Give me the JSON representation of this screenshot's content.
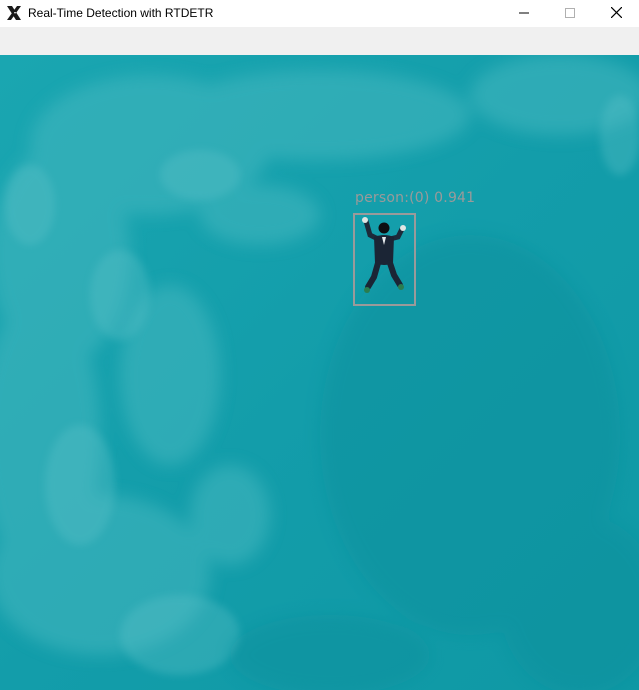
{
  "window": {
    "title": "Real-Time Detection with RTDETR",
    "app_icon": "x-app-icon",
    "controls": {
      "minimize_icon": "minimize-icon",
      "maximize_icon": "maximize-icon",
      "close_icon": "close-icon"
    }
  },
  "detections": [
    {
      "label": "person:(0)  0.941",
      "class": "person",
      "id": 0,
      "confidence": 0.941,
      "color": "#9a9a9a"
    }
  ],
  "colors": {
    "water": "#14a0ac",
    "toolbar": "#f0f0f0",
    "box": "#9a9a9a"
  }
}
